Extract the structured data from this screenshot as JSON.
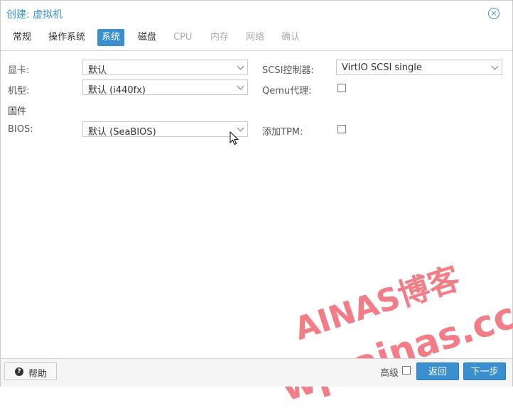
{
  "window": {
    "title": "创建: 虚拟机"
  },
  "tabs": [
    {
      "label": "常规"
    },
    {
      "label": "操作系统"
    },
    {
      "label": "系统"
    },
    {
      "label": "磁盘"
    },
    {
      "label": "CPU"
    },
    {
      "label": "内存"
    },
    {
      "label": "网络"
    },
    {
      "label": "确认"
    }
  ],
  "form": {
    "graphics_label": "显卡:",
    "graphics_value": "默认",
    "machine_label": "机型:",
    "machine_value": "默认 (i440fx)",
    "firmware_heading": "固件",
    "bios_label": "BIOS:",
    "bios_value": "默认 (SeaBIOS)",
    "scsi_label": "SCSI控制器:",
    "scsi_value": "VirtIO SCSI single",
    "qemu_label": "Qemu代理:",
    "tpm_label": "添加TPM:"
  },
  "watermark": {
    "line1": "AINAS博客",
    "line2": "wp.ainas.cc"
  },
  "footer": {
    "help_label": "帮助",
    "advanced_label": "高级",
    "back_label": "返回",
    "next_label": "下一步"
  },
  "colors": {
    "accent": "#3a8fd1",
    "watermark": "#f27d86"
  },
  "icons": [
    "close-icon",
    "chevron-down-icon",
    "help-icon",
    "checkbox-icon",
    "mouse-cursor-icon"
  ]
}
